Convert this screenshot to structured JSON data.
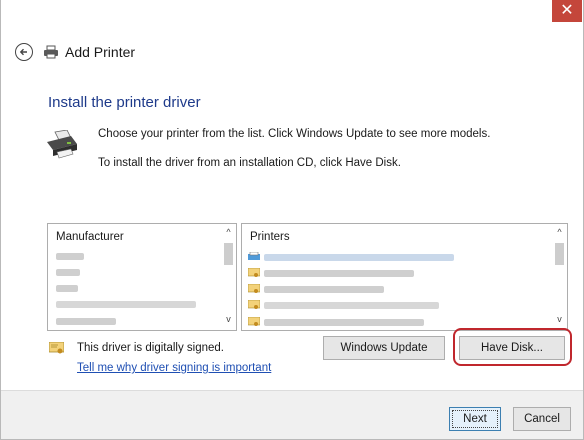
{
  "window": {
    "title": "Add Printer",
    "close_glyph": "✕"
  },
  "main": {
    "heading": "Install the printer driver",
    "line1": "Choose your printer from the list. Click Windows Update to see more models.",
    "line2": "To install the driver from an installation CD, click Have Disk."
  },
  "manufacturer_list": {
    "header": "Manufacturer"
  },
  "printers_list": {
    "header": "Printers"
  },
  "signing": {
    "text": "This driver is digitally signed.",
    "link": "Tell me why driver signing is important"
  },
  "buttons": {
    "windows_update": "Windows Update",
    "have_disk": "Have Disk...",
    "next": "Next",
    "cancel": "Cancel"
  },
  "colors": {
    "heading": "#1e3a8a",
    "link": "#1f4fb3",
    "close": "#c4463b",
    "highlight": "#c0272d"
  },
  "icons": [
    "back-arrow-icon",
    "printer-icon",
    "certificate-icon",
    "close-icon"
  ]
}
